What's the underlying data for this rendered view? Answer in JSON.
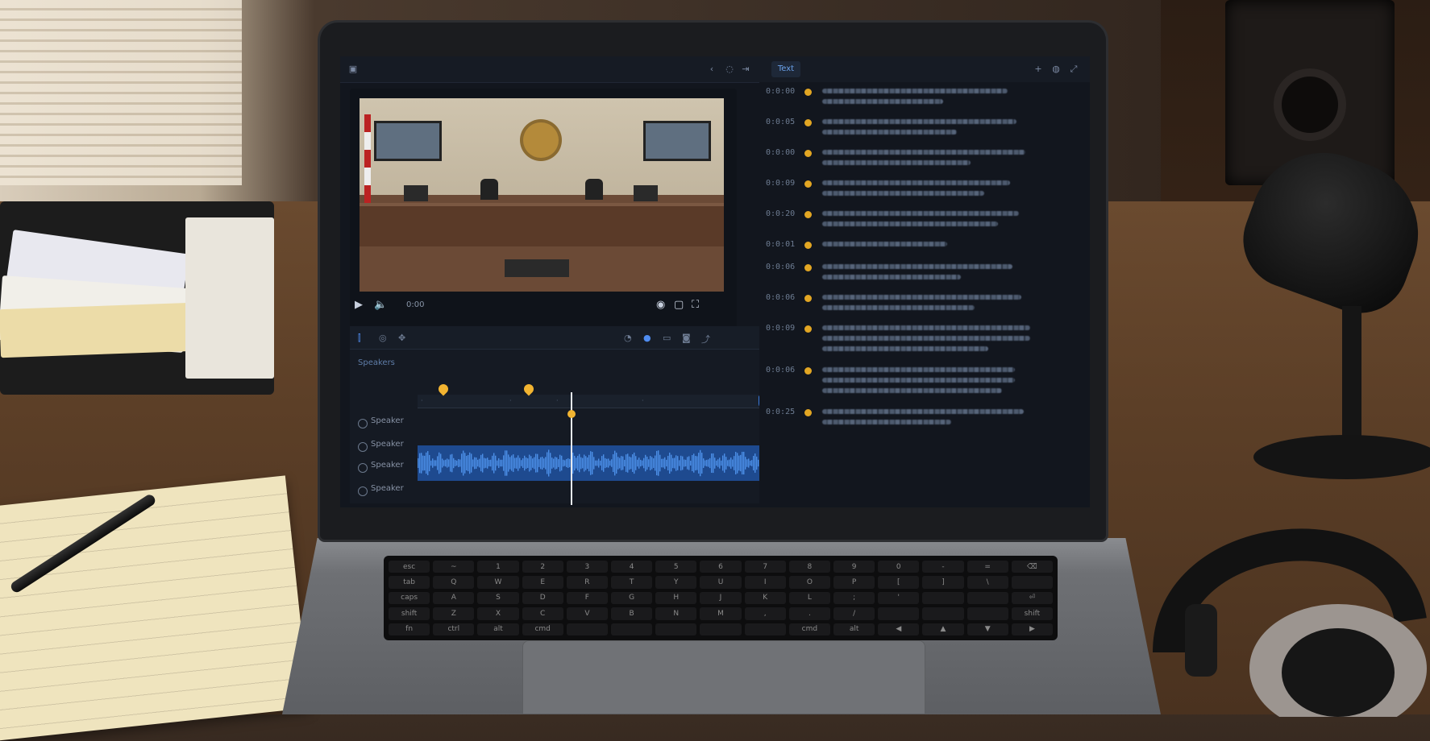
{
  "app": {
    "transcript_tab_label": "Text",
    "video": {
      "timecode": "0:00",
      "controls": [
        "play-icon",
        "volume-icon",
        "settings-icon",
        "pip-icon",
        "fullscreen-icon"
      ]
    },
    "timeline": {
      "section_label": "Speakers",
      "tracks": [
        "Speaker",
        "Speaker",
        "Speaker",
        "Speaker"
      ],
      "tools": [
        "trim-icon",
        "record-icon",
        "split-icon"
      ],
      "right_tools": [
        "comment-icon",
        "speaker-icon",
        "caption-icon",
        "chat-icon",
        "share-icon"
      ]
    },
    "transcript": [
      {
        "time": "0:0:00"
      },
      {
        "time": "0:0:05"
      },
      {
        "time": "0:0:00"
      },
      {
        "time": "0:0:09"
      },
      {
        "time": "0:0:20"
      },
      {
        "time": "0:0:01"
      },
      {
        "time": "0:0:06"
      },
      {
        "time": "0:0:06"
      },
      {
        "time": "0:0:09"
      },
      {
        "time": "0:0:06"
      },
      {
        "time": "0:0:25"
      }
    ]
  },
  "keyboard": {
    "row1": [
      "esc",
      "~",
      "1",
      "2",
      "3",
      "4",
      "5",
      "6",
      "7",
      "8",
      "9",
      "0",
      "-",
      "=",
      "⌫"
    ],
    "row2": [
      "tab",
      "Q",
      "W",
      "E",
      "R",
      "T",
      "Y",
      "U",
      "I",
      "O",
      "P",
      "[",
      "]",
      "\\",
      ""
    ],
    "row3": [
      "caps",
      "A",
      "S",
      "D",
      "F",
      "G",
      "H",
      "J",
      "K",
      "L",
      ";",
      "'",
      "",
      "",
      "⏎"
    ],
    "row4": [
      "shift",
      "Z",
      "X",
      "C",
      "V",
      "B",
      "N",
      "M",
      ",",
      ".",
      "/",
      "",
      "",
      "",
      "shift"
    ],
    "row5": [
      "fn",
      "ctrl",
      "alt",
      "cmd",
      "",
      "",
      "",
      "",
      "",
      "cmd",
      "alt",
      "◀",
      "▲",
      "▼",
      "▶"
    ]
  },
  "colors": {
    "accent": "#3a7be0",
    "marker": "#f2b431",
    "waveform": "#2f6fd0",
    "panel": "#12161e"
  }
}
